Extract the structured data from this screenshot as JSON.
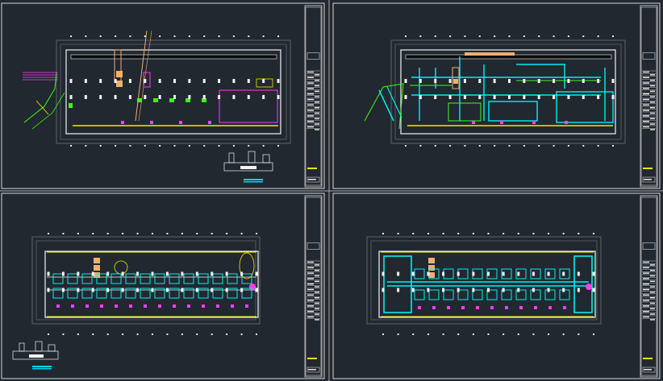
{
  "app": {
    "background": "#212830",
    "layout_colors": {
      "frame": "#d8d8d8",
      "wall": "#f2f2f2",
      "grid_dim": "#5a636c",
      "pipe_cyan": "#00f0f0",
      "pipe_green": "#39ff14",
      "pipe_magenta": "#ff3df5",
      "pipe_yellow": "#f5e700",
      "accent_orange": "#f0b070",
      "accent_red": "#ff2a2a",
      "title_block_highlight": "#f5e700",
      "title_block_cyan": "#00d8f0"
    }
  },
  "sheets": [
    {
      "id": "sheet-top-left",
      "kind": "floor-plan",
      "variant": "basement-ventilation"
    },
    {
      "id": "sheet-top-right",
      "kind": "floor-plan",
      "variant": "basement-ductwork"
    },
    {
      "id": "sheet-bottom-left",
      "kind": "floor-plan",
      "variant": "typical-floor-ventilation"
    },
    {
      "id": "sheet-bottom-right",
      "kind": "floor-plan",
      "variant": "typical-floor-ductwork"
    }
  ],
  "icons": {
    "title_block": "title-block-icon",
    "legend_detail": "legend-detail-icon"
  }
}
